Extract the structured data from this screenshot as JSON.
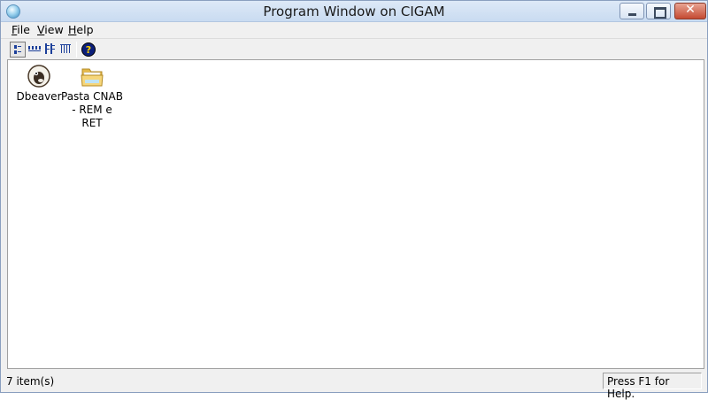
{
  "window": {
    "title": "Program Window on CIGAM",
    "close_label": "✕"
  },
  "menu": [
    {
      "key": "F",
      "rest": "ile"
    },
    {
      "key": "V",
      "rest": "iew"
    },
    {
      "key": "H",
      "rest": "elp"
    }
  ],
  "toolbar": {
    "buttons": [
      "large-icons-view-icon",
      "small-icons-view-icon",
      "list-view-icon",
      "details-view-icon",
      "help-icon"
    ]
  },
  "items": [
    {
      "label": "Dbeaver",
      "icon": "dbeaver-icon"
    },
    {
      "label": "Pasta CNAB - REM e RET",
      "icon": "folder-icon"
    }
  ],
  "status": {
    "count": "7 item(s)",
    "help": "Press F1 for Help."
  }
}
